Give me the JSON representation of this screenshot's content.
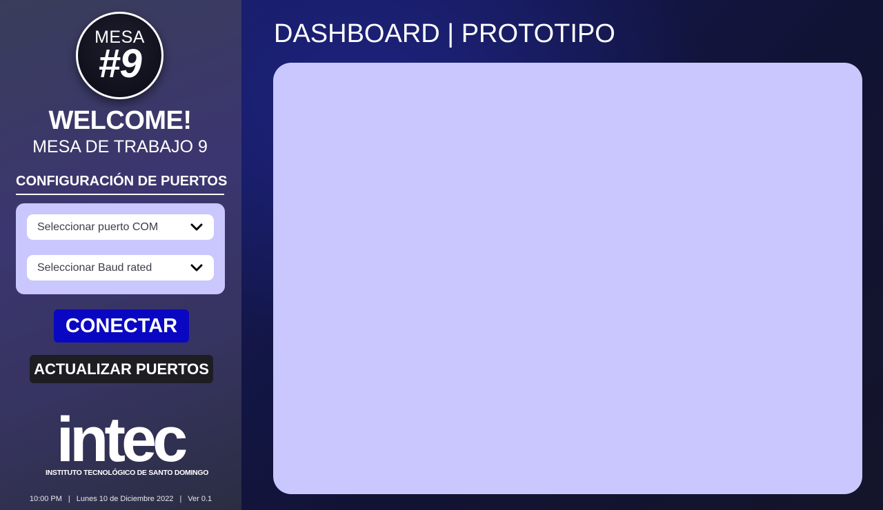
{
  "sidebar": {
    "badge": {
      "top": "MESA",
      "number": "#9"
    },
    "welcome": "WELCOME!",
    "subtitle": "MESA DE TRABAJO 9",
    "config_title": "CONFIGURACIÓN DE PUERTOS",
    "selects": [
      {
        "value": "Seleccionar puerto COM",
        "icon": "chevron-down-icon"
      },
      {
        "value": "Seleccionar Baud rated",
        "icon": "chevron-down-icon"
      }
    ],
    "connect_label": "CONECTAR",
    "refresh_label": "ACTUALIZAR PUERTOS",
    "logo": {
      "word": "intec",
      "subtitle": "INSTITUTO TECNOLÓGICO DE SANTO DOMINGO"
    },
    "footer": {
      "time": "10:00 PM",
      "date": "Lunes 10 de Diciembre 2022",
      "version": "Ver 0.1",
      "separator": "|"
    }
  },
  "main": {
    "title": "DASHBOARD | PROTOTIPO"
  },
  "colors": {
    "panel": "#c9c7fd",
    "connect_button": "#0a07c3",
    "refresh_button": "#1e1e22",
    "main_background": "#15185a"
  }
}
